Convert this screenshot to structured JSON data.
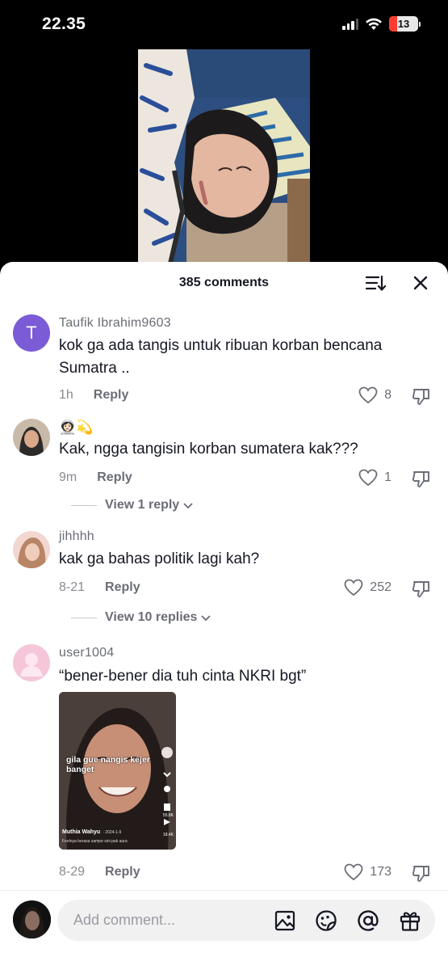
{
  "status_bar": {
    "time": "22.35",
    "battery": "13"
  },
  "sheet": {
    "comments_count": "385 comments"
  },
  "comments": [
    {
      "avatar_letter": "T",
      "username": "Taufik Ibrahim9603",
      "text": "kok ga ada tangis untuk ribuan korban bencana Sumatra ..",
      "time": "1h",
      "reply": "Reply",
      "likes": "8"
    },
    {
      "username": "👩🏻‍🚀💫",
      "text": "Kak, ngga tangisin korban sumatera kak???",
      "time": "9m",
      "reply": "Reply",
      "likes": "1",
      "view_replies": "View 1 reply"
    },
    {
      "username": "jihhhh",
      "text": "kak ga bahas politik lagi kah?",
      "time": "8-21",
      "reply": "Reply",
      "likes": "252",
      "view_replies": "View 10 replies"
    },
    {
      "username": "user1004",
      "text": "“bener-bener dia tuh cinta NKRI bgt”",
      "attachment": {
        "caption": "gila gue nangis kejer banget",
        "author": "Muthia Wahyu",
        "date": "· 2024-1-9",
        "desc": "Feelnya berasa sampe sini pak aura",
        "stat1": "55.8K",
        "stat2": "18.4K"
      },
      "time": "8-29",
      "reply": "Reply",
      "likes": "173"
    }
  ],
  "bottom_bar": {
    "placeholder": "Add comment..."
  },
  "colors": {
    "accent_avatar": "#7b5bd6",
    "text_primary": "#161823",
    "text_secondary": "#6b6d76"
  }
}
